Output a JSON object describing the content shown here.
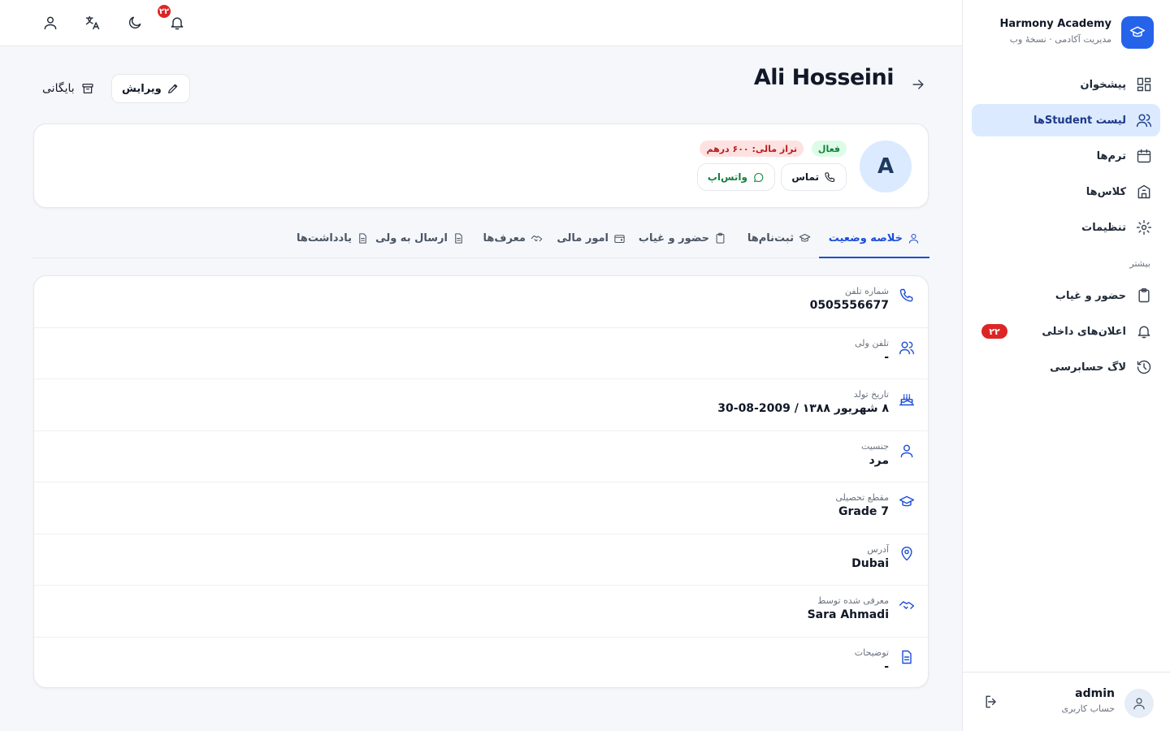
{
  "brand": {
    "name": "Harmony Academy",
    "subtitle": "مدیریت آکادمی · نسخهٔ وب"
  },
  "sidebar": {
    "items": [
      {
        "label": "پیشخوان",
        "icon": "dashboard-icon"
      },
      {
        "label": "لیست Studentها",
        "icon": "users-icon",
        "active": true
      },
      {
        "label": "ترم‌ها",
        "icon": "calendar-icon"
      },
      {
        "label": "کلاس‌ها",
        "icon": "building-icon"
      },
      {
        "label": "تنظیمات",
        "icon": "gear-icon"
      }
    ],
    "section_label": "بیشتر",
    "more_items": [
      {
        "label": "حضور و غیاب",
        "icon": "clipboard-icon"
      },
      {
        "label": "اعلان‌های داخلی",
        "icon": "bell-icon",
        "badge": "۲۲"
      },
      {
        "label": "لاگ حسابرسی",
        "icon": "history-icon"
      }
    ],
    "user": {
      "name": "admin",
      "role": "حساب کاربری"
    }
  },
  "topbar": {
    "notification_count": "۲۲"
  },
  "page": {
    "title": "Ali Hosseini",
    "edit_label": "ویرایش",
    "archive_label": "بایگانی"
  },
  "profile": {
    "initial": "A",
    "status": "فعال",
    "balance": "تراز مالی: ۶۰۰ درهم",
    "call_label": "تماس",
    "whatsapp_label": "واتس‌اپ"
  },
  "tabs": [
    {
      "label": "خلاصه وضعیت",
      "active": true
    },
    {
      "label": "ثبت‌نام‌ها"
    },
    {
      "label": "حضور و غیاب"
    },
    {
      "label": "امور مالی"
    },
    {
      "label": "معرف‌ها"
    },
    {
      "label": "ارسال به ولی"
    },
    {
      "label": "یادداشت‌ها"
    }
  ],
  "details": [
    {
      "label": "شماره تلفن",
      "value": "0505556677",
      "icon": "phone-icon"
    },
    {
      "label": "تلفن ولی",
      "value": "-",
      "icon": "users-icon"
    },
    {
      "label": "تاریخ تولد",
      "value": "۸ شهریور ۱۳۸۸ / 2009-08-30",
      "icon": "cake-icon"
    },
    {
      "label": "جنسیت",
      "value": "مرد",
      "icon": "user-icon"
    },
    {
      "label": "مقطع تحصیلی",
      "value": "Grade 7",
      "icon": "graduation-cap-icon"
    },
    {
      "label": "آدرس",
      "value": "Dubai",
      "icon": "map-pin-icon"
    },
    {
      "label": "معرفی شده توسط",
      "value": "Sara Ahmadi",
      "icon": "handshake-icon"
    },
    {
      "label": "توضیحات",
      "value": "-",
      "icon": "document-icon"
    }
  ],
  "colors": {
    "accent": "#2563eb",
    "active_bg": "#dbeafe",
    "danger": "#dc2626",
    "success": "#15803d"
  }
}
